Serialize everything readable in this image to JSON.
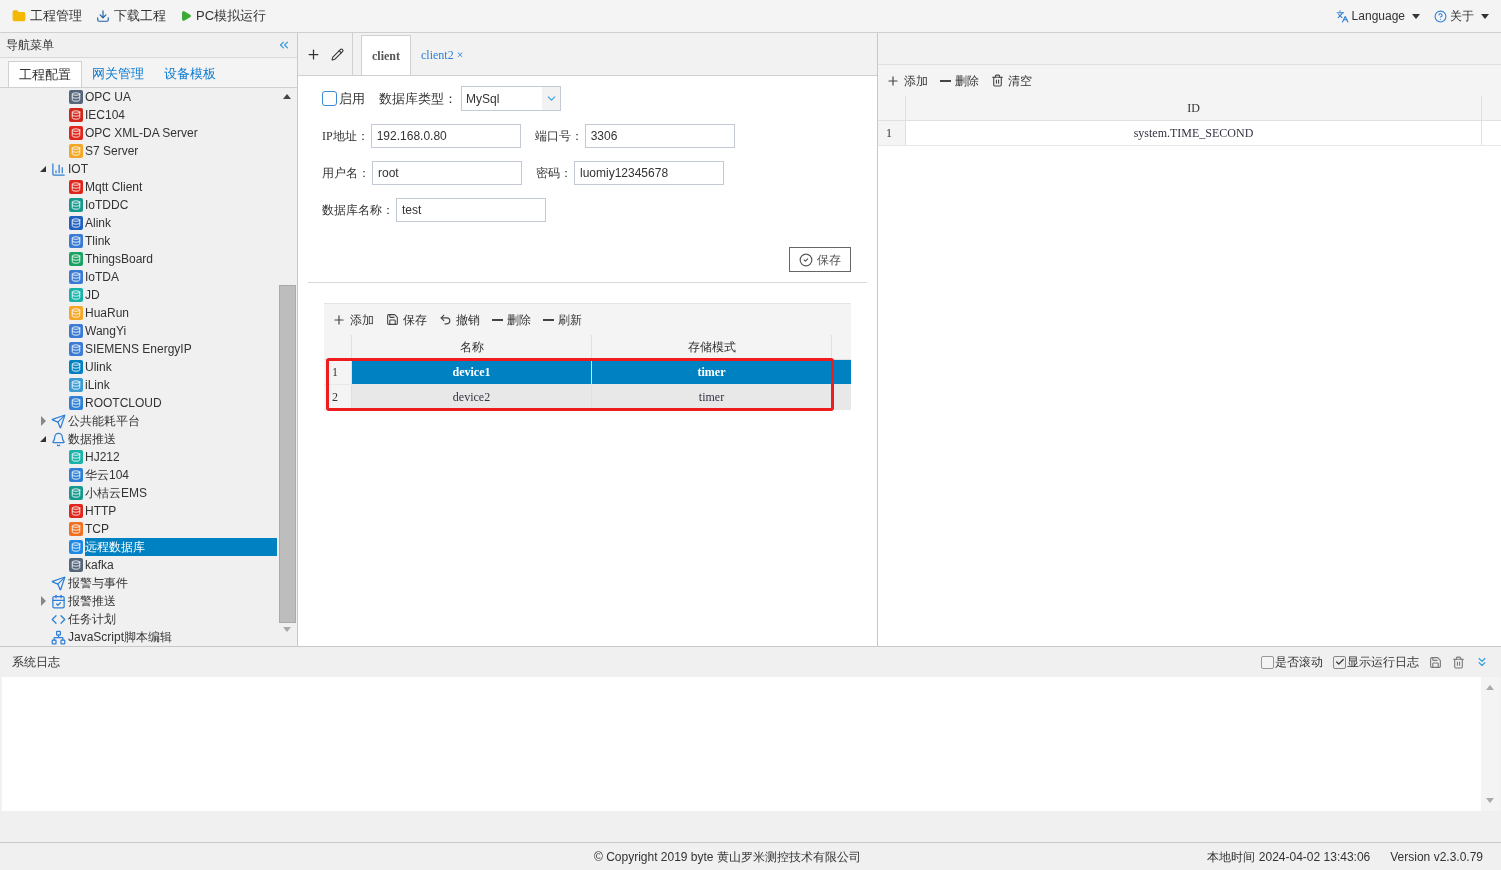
{
  "toolbar": [
    {
      "kind": "folder",
      "label": "工程管理"
    },
    {
      "kind": "download",
      "label": "下载工程"
    },
    {
      "kind": "play",
      "label": "PC模拟运行"
    }
  ],
  "top_right": {
    "language": "Language",
    "about": "关于"
  },
  "nav": {
    "title": "导航菜单",
    "tabs": [
      {
        "label": "工程配置",
        "selected": true
      },
      {
        "label": "网关管理",
        "selected": false
      },
      {
        "label": "设备模板",
        "selected": false
      }
    ],
    "tree": [
      {
        "children": [
          {
            "label": "OPC UA",
            "selected": false
          },
          {
            "label": "IEC104",
            "selected": false
          },
          {
            "label": "OPC XML-DA Server",
            "selected": false
          },
          {
            "label": "S7 Server",
            "selected": false
          }
        ]
      },
      {
        "label": "IOT",
        "expanded": true,
        "selected": false,
        "children": [
          {
            "label": "Mqtt Client",
            "selected": false
          },
          {
            "label": "IoTDDC",
            "selected": false
          },
          {
            "label": "Alink",
            "selected": false
          },
          {
            "label": "Tlink",
            "selected": false
          },
          {
            "label": "ThingsBoard",
            "selected": false
          },
          {
            "label": "IoTDA",
            "selected": false
          },
          {
            "label": "JD",
            "selected": false
          },
          {
            "label": "HuaRun",
            "selected": false
          },
          {
            "label": "WangYi",
            "selected": false
          },
          {
            "label": "SIEMENS EnergyIP",
            "selected": false
          },
          {
            "label": "Ulink",
            "selected": false
          },
          {
            "label": "iLink",
            "selected": false
          },
          {
            "label": "ROOTCLOUD",
            "selected": false
          }
        ]
      },
      {
        "label": "公共能耗平台",
        "expanded": false,
        "selected": false
      },
      {
        "label": "数据推送",
        "expanded": true,
        "selected": false,
        "children": [
          {
            "label": "HJ212",
            "selected": false
          },
          {
            "label": "华云104",
            "selected": false
          },
          {
            "label": "小桔云EMS",
            "selected": false
          },
          {
            "label": "HTTP",
            "selected": false
          },
          {
            "label": "TCP",
            "selected": false
          },
          {
            "label": "远程数据库",
            "selected": true
          },
          {
            "label": "kafka",
            "selected": false
          }
        ]
      },
      {
        "label": "报警与事件",
        "selected": false
      },
      {
        "label": "报警推送",
        "expanded": false,
        "selected": false
      },
      {
        "label": "任务计划",
        "selected": false
      },
      {
        "label": "JavaScript脚本编辑",
        "selected": false
      }
    ]
  },
  "editor_tabs": [
    {
      "label": "client",
      "selected": true
    },
    {
      "label": "client2",
      "selected": false,
      "close": "×"
    }
  ],
  "form": {
    "enabled": {
      "label": "启用",
      "checked": false
    },
    "db_type": {
      "label": "数据库类型：",
      "value": "MySql"
    },
    "rows": [
      [
        {
          "label": "IP地址：",
          "value": "192.168.0.80"
        },
        {
          "label": "端口号：",
          "value": "3306"
        }
      ],
      [
        {
          "label": "用户名：",
          "value": "root"
        },
        {
          "label": "密码：",
          "value": "luomiy12345678"
        }
      ],
      [
        {
          "label": "数据库名称：",
          "value": "test"
        }
      ]
    ],
    "save": "保存"
  },
  "device_table": {
    "toolbar": [
      {
        "kind": "add",
        "label": "添加"
      },
      {
        "kind": "save",
        "label": "保存"
      },
      {
        "kind": "undo",
        "label": "撤销"
      },
      {
        "kind": "remove",
        "label": "删除"
      },
      {
        "kind": "remove",
        "label": "刷新"
      }
    ],
    "columns": [
      "名称",
      "存储模式"
    ],
    "rows": [
      {
        "index": "1",
        "cells": [
          "device1",
          "timer"
        ],
        "selected": true
      },
      {
        "index": "2",
        "cells": [
          "device2",
          "timer"
        ],
        "selected": false
      }
    ]
  },
  "tag_table": {
    "toolbar": [
      {
        "kind": "add",
        "label": "添加"
      },
      {
        "kind": "remove",
        "label": "删除"
      },
      {
        "kind": "trash",
        "label": "清空"
      }
    ],
    "columns": [
      "ID"
    ],
    "rows": [
      {
        "index": "1",
        "cells": [
          "system.TIME_SECOND"
        ],
        "selected": false
      }
    ]
  },
  "log": {
    "title": "系统日志",
    "options": [
      {
        "label": "是否滚动",
        "checked": false
      },
      {
        "label": "显示运行日志",
        "checked": true
      }
    ]
  },
  "footer": {
    "copyright": "© Copyright 2019 byte 黄山罗米测控技术有限公司",
    "time_label": "本地时间",
    "time": "2024-04-02 13:43:06",
    "version": "Version v2.3.0.79"
  }
}
